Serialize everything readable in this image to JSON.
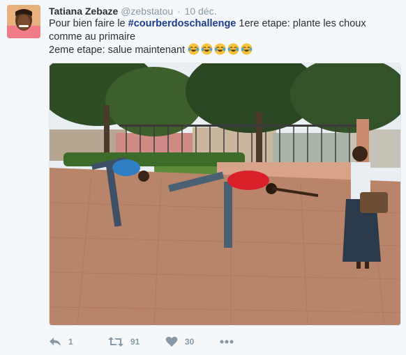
{
  "tweet": {
    "author": {
      "fullname": "Tatiana Zebaze",
      "username": "@zebstatou",
      "separator": "·",
      "timestamp": "10 déc."
    },
    "text": {
      "prefix": "Pour bien faire le ",
      "hashtag": "#courberdoschallenge",
      "line1_suffix": " 1ere etape: plante les choux comme au primaire",
      "line2": "2eme etape: salue maintenant ",
      "emoji_name": "face-with-tears-of-joy",
      "emoji_count": 5
    },
    "photo": {
      "icon": "tweet-photo"
    },
    "actions": {
      "reply": {
        "icon": "reply-icon",
        "count": "1"
      },
      "retweet": {
        "icon": "retweet-icon",
        "count": "91"
      },
      "like": {
        "icon": "heart-icon",
        "count": "30"
      },
      "more": {
        "icon": "more-icon"
      }
    },
    "colors": {
      "background": "#f5f8fa",
      "hashtag": "#1b3c8c",
      "muted": "#8899a6",
      "text": "#292f33"
    }
  }
}
